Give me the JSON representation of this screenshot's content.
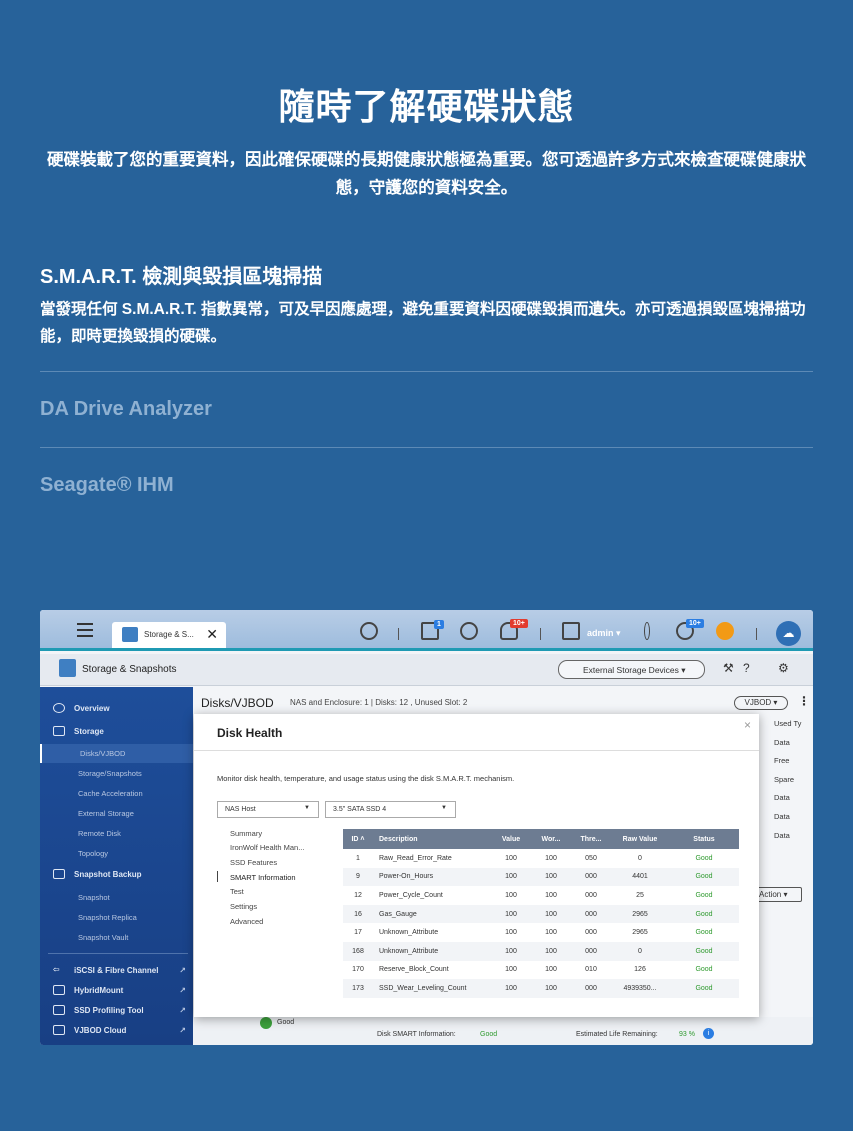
{
  "hero": {
    "title": "隨時了解硬碟狀態",
    "desc": "硬碟裝載了您的重要資料，因此確保硬碟的長期健康狀態極為重要。您可透過許多方式來檢查硬碟健康狀態，守護您的資料安全。"
  },
  "feature": {
    "title": "S.M.A.R.T. 檢測與毀損區塊掃描",
    "desc": "當發現任何 S.M.A.R.T. 指數異常，可及早因應處理，避免重要資料因硬碟毀損而遺失。亦可透過損毀區塊掃描功能，即時更換毀損的硬碟。"
  },
  "accordion": [
    "DA Drive Analyzer",
    "Seagate® IHM"
  ],
  "ui": {
    "tab_label": "Storage & S...",
    "tab_close": "✕",
    "badge1": "1",
    "badge_notif": "10+",
    "admin": "admin ▾",
    "badge_info": "10+",
    "app_title": "Storage & Snapshots",
    "ext_btn": "External Storage Devices ▾",
    "breadcrumb": "Disks/VJBOD",
    "crumb_meta": "NAS and Enclosure: 1 | Disks: 12 , Unused Slot: 2",
    "vjbod_btn": "VJBOD ▾",
    "sidebar": [
      {
        "label": "Overview",
        "type": "main"
      },
      {
        "label": "Storage",
        "type": "main"
      },
      {
        "label": "Disks/VJBOD",
        "type": "sub",
        "active": true
      },
      {
        "label": "Storage/Snapshots",
        "type": "sub"
      },
      {
        "label": "Cache Acceleration",
        "type": "sub"
      },
      {
        "label": "External Storage",
        "type": "sub"
      },
      {
        "label": "Remote Disk",
        "type": "sub"
      },
      {
        "label": "Topology",
        "type": "sub"
      },
      {
        "label": "Snapshot Backup",
        "type": "main"
      },
      {
        "label": "Snapshot",
        "type": "sub"
      },
      {
        "label": "Snapshot Replica",
        "type": "sub"
      },
      {
        "label": "Snapshot Vault",
        "type": "sub"
      },
      {
        "label": "iSCSI & Fibre Channel",
        "type": "main"
      },
      {
        "label": "HybridMount",
        "type": "main"
      },
      {
        "label": "SSD Profiling Tool",
        "type": "main"
      },
      {
        "label": "VJBOD Cloud",
        "type": "main"
      }
    ],
    "right_col": [
      "Used Ty",
      "Data",
      "Free",
      "Spare",
      "Data",
      "Data",
      "Data"
    ],
    "action_label": "Action ▾",
    "bottom": {
      "good": "Good",
      "smart_label": "Disk SMART Information:",
      "smart_value": "Good",
      "life_label": "Estimated Life Remaining:",
      "life_value": "93 %"
    }
  },
  "modal": {
    "title": "Disk Health",
    "close": "×",
    "desc": "Monitor disk health, temperature, and usage status using the disk S.M.A.R.T. mechanism.",
    "host_select": "NAS Host",
    "disk_select": "3.5\" SATA SSD 4",
    "menu": [
      "Summary",
      "IronWolf Health Man...",
      "SSD Features",
      "SMART Information",
      "Test",
      "Settings",
      "Advanced"
    ],
    "columns": [
      "ID ˄",
      "Description",
      "Value",
      "Wor...",
      "Thre...",
      "Raw Value",
      "Status"
    ],
    "rows": [
      [
        "1",
        "Raw_Read_Error_Rate",
        "100",
        "100",
        "050",
        "0",
        "Good"
      ],
      [
        "9",
        "Power-On_Hours",
        "100",
        "100",
        "000",
        "4401",
        "Good"
      ],
      [
        "12",
        "Power_Cycle_Count",
        "100",
        "100",
        "000",
        "25",
        "Good"
      ],
      [
        "16",
        "Gas_Gauge",
        "100",
        "100",
        "000",
        "2965",
        "Good"
      ],
      [
        "17",
        "Unknown_Attribute",
        "100",
        "100",
        "000",
        "2965",
        "Good"
      ],
      [
        "168",
        "Unknown_Attribute",
        "100",
        "100",
        "000",
        "0",
        "Good"
      ],
      [
        "170",
        "Reserve_Block_Count",
        "100",
        "100",
        "010",
        "126",
        "Good"
      ],
      [
        "173",
        "SSD_Wear_Leveling_Count",
        "100",
        "100",
        "000",
        "4939350...",
        "Good"
      ]
    ]
  }
}
